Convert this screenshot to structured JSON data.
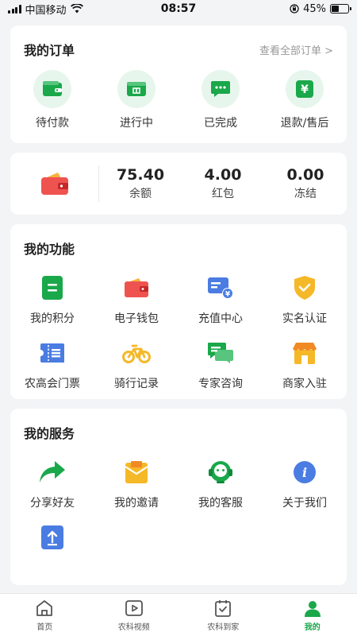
{
  "status_bar": {
    "carrier": "中国移动",
    "time": "08:57",
    "battery": "45%"
  },
  "orders": {
    "title": "我的订单",
    "view_all": "查看全部订单 >",
    "items": [
      {
        "label": "待付款",
        "icon": "wallet-icon"
      },
      {
        "label": "进行中",
        "icon": "store-icon"
      },
      {
        "label": "已完成",
        "icon": "chat-icon"
      },
      {
        "label": "退款/售后",
        "icon": "yen-icon"
      }
    ]
  },
  "wallet": {
    "stats": [
      {
        "value": "75.40",
        "label": "余额"
      },
      {
        "value": "4.00",
        "label": "红包"
      },
      {
        "value": "0.00",
        "label": "冻结"
      }
    ]
  },
  "features": {
    "title": "我的功能",
    "items": [
      {
        "label": "我的积分",
        "icon": "points-icon"
      },
      {
        "label": "电子钱包",
        "icon": "e-wallet-icon"
      },
      {
        "label": "充值中心",
        "icon": "recharge-icon"
      },
      {
        "label": "实名认证",
        "icon": "verify-shield-icon"
      },
      {
        "label": "农高会门票",
        "icon": "ticket-icon"
      },
      {
        "label": "骑行记录",
        "icon": "bicycle-icon"
      },
      {
        "label": "专家咨询",
        "icon": "consult-icon"
      },
      {
        "label": "商家入驻",
        "icon": "shop-icon"
      }
    ]
  },
  "services": {
    "title": "我的服务",
    "items": [
      {
        "label": "分享好友",
        "icon": "share-icon"
      },
      {
        "label": "我的邀请",
        "icon": "invite-icon"
      },
      {
        "label": "我的客服",
        "icon": "customer-service-icon"
      },
      {
        "label": "关于我们",
        "icon": "info-icon"
      },
      {
        "label": "",
        "icon": "upload-icon"
      }
    ]
  },
  "tabbar": {
    "items": [
      {
        "label": "首页",
        "icon": "home-icon"
      },
      {
        "label": "农科视频",
        "icon": "video-icon"
      },
      {
        "label": "农科到家",
        "icon": "calendar-check-icon"
      },
      {
        "label": "我的",
        "icon": "user-icon"
      }
    ],
    "active": "我的"
  },
  "colors": {
    "accent": "#1aa84a",
    "order_icon_bg": "#e7f6ec",
    "wallet_red": "#ef5350"
  }
}
